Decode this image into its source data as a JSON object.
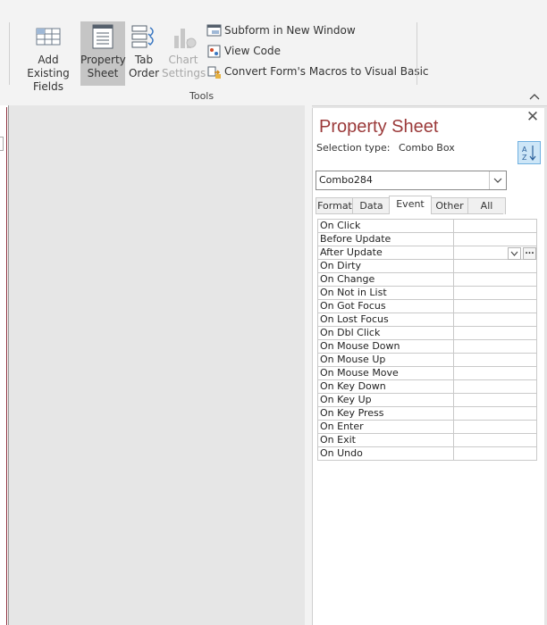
{
  "ribbon": {
    "buttons": {
      "add_existing_fields": {
        "line1": "Add Existing",
        "line2": "Fields"
      },
      "property_sheet": {
        "line1": "Property",
        "line2": "Sheet"
      },
      "tab_order": {
        "line1": "Tab",
        "line2": "Order"
      },
      "chart_settings": {
        "line1": "Chart",
        "line2": "Settings"
      }
    },
    "small_commands": {
      "subform": "Subform in New Window",
      "view_code": "View Code",
      "convert_macros": "Convert Form's Macros to Visual Basic"
    },
    "group_label": "Tools"
  },
  "property_sheet": {
    "title": "Property Sheet",
    "selection_type_label": "Selection type:",
    "selection_type_value": "Combo Box",
    "selected_control": "Combo284",
    "close_glyph": "✕",
    "tabs": [
      "Format",
      "Data",
      "Event",
      "Other",
      "All"
    ],
    "active_tab": "Event",
    "events": [
      "On Click",
      "Before Update",
      "After Update",
      "On Dirty",
      "On Change",
      "On Not in List",
      "On Got Focus",
      "On Lost Focus",
      "On Dbl Click",
      "On Mouse Down",
      "On Mouse Up",
      "On Mouse Move",
      "On Key Down",
      "On Key Up",
      "On Key Press",
      "On Enter",
      "On Exit",
      "On Undo"
    ],
    "focused_event": "After Update",
    "builder_glyph": "..."
  },
  "colors": {
    "accent_title": "#9b3a3a",
    "sort_button_bg": "#cde6f7",
    "active_ribbon_button": "#c5c5c5"
  }
}
